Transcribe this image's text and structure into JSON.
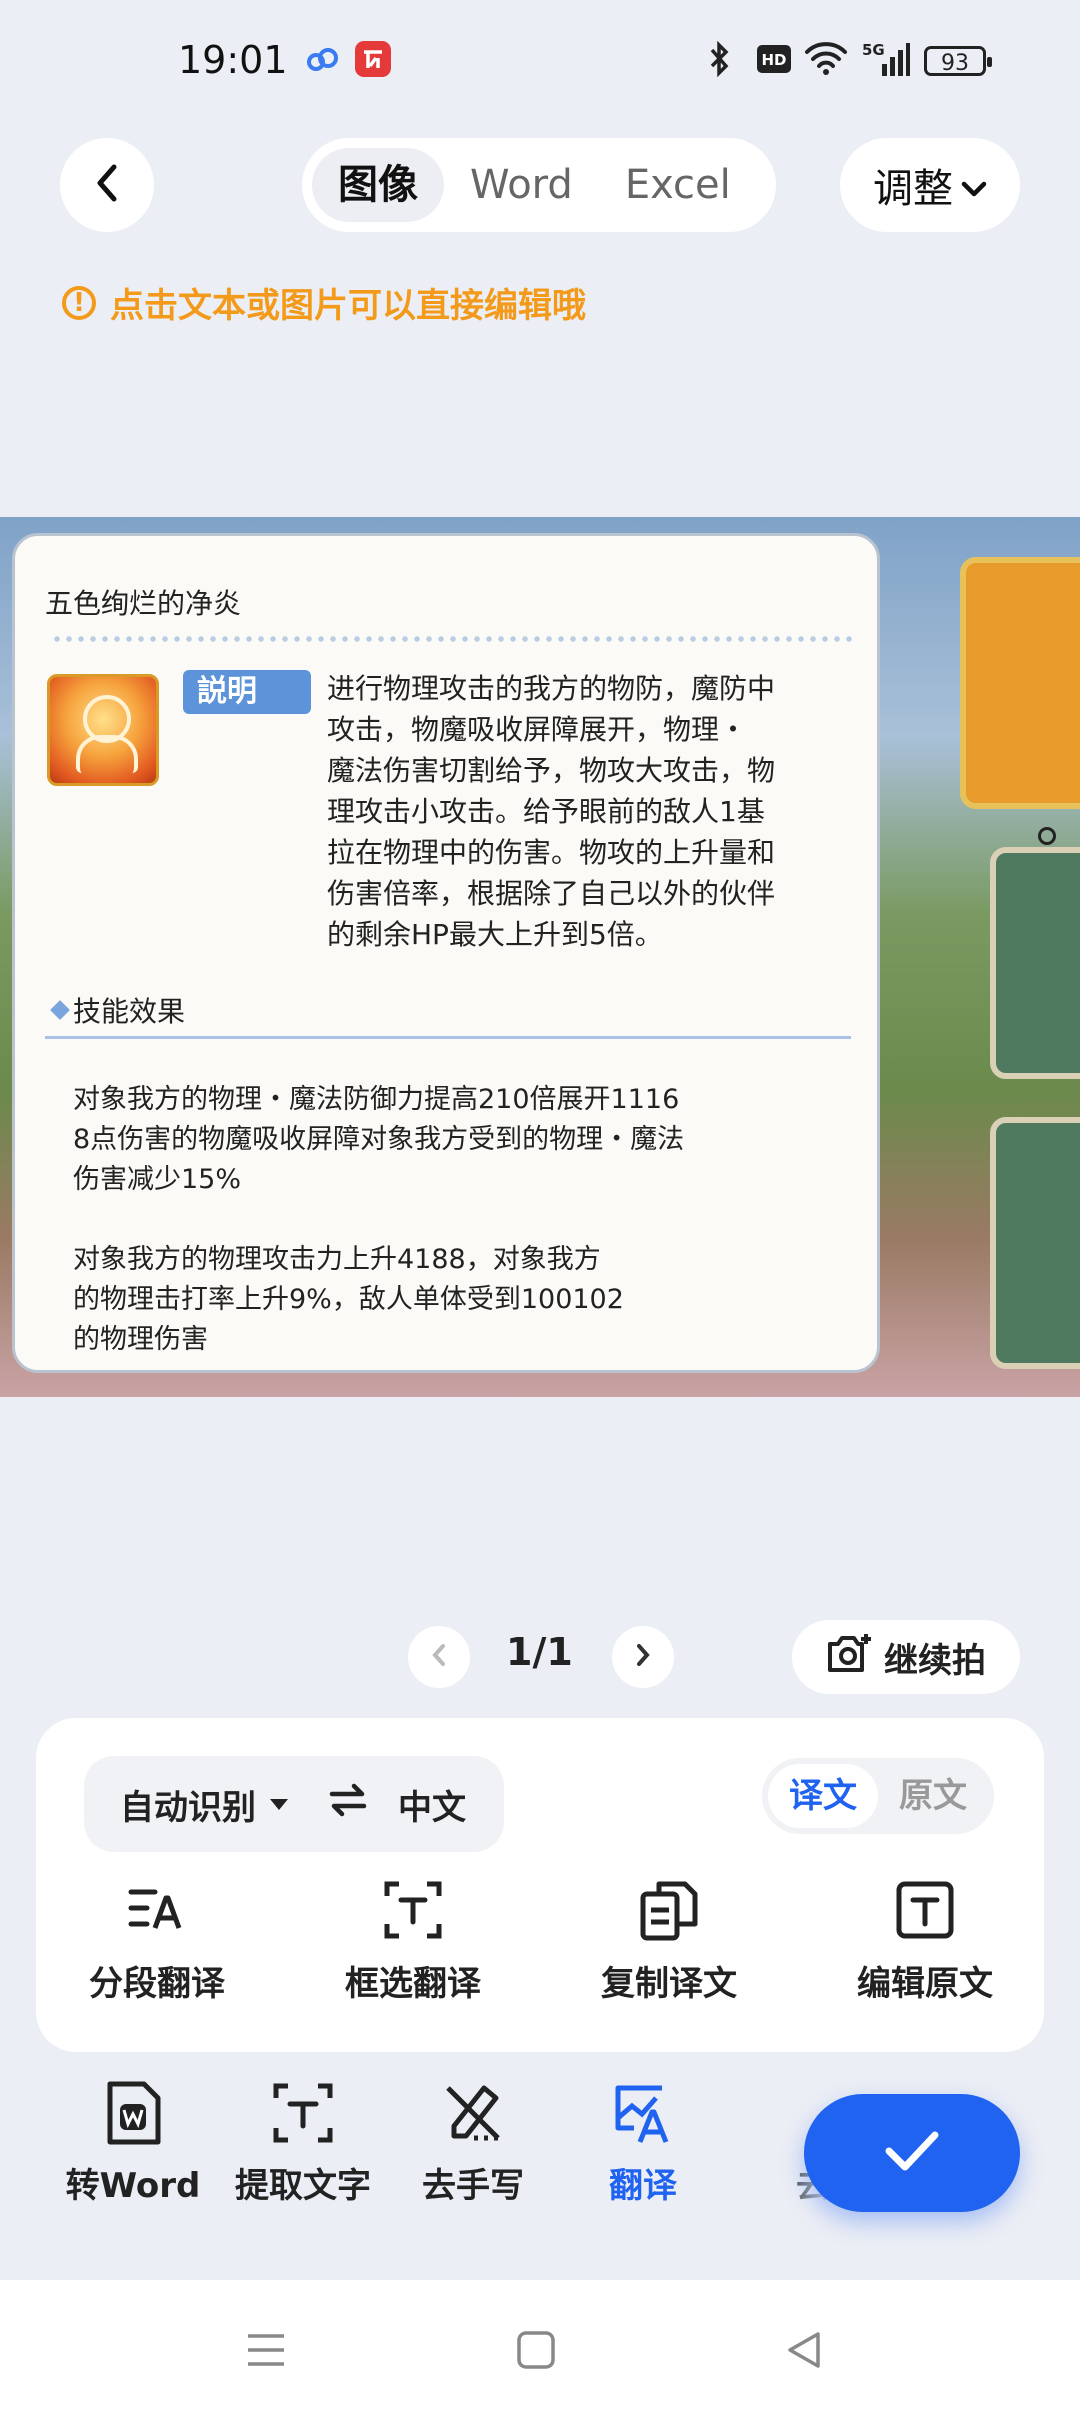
{
  "status_bar": {
    "time": "19:01",
    "battery": "93",
    "network": "5G"
  },
  "header": {
    "tabs": [
      {
        "label": "图像",
        "active": true
      },
      {
        "label": "Word",
        "active": false
      },
      {
        "label": "Excel",
        "active": false
      }
    ],
    "adjust_label": "调整",
    "tip": "点击文本或图片可以直接编辑哦"
  },
  "card": {
    "title": "五色绚烂的净炎",
    "badge": "説明",
    "description": "进行物理攻击的我方的物防，魔防中\n攻击，物魔吸收屏障展开，物理・\n魔法伤害切割给予，物攻大攻击，物\n理攻击小攻击。给予眼前的敌人1基\n拉在物理中的伤害。物攻的上升量和\n伤害倍率，根据除了自己以外的伙伴\n的剩余HP最大上升到5倍。",
    "effect_heading": "技能效果",
    "effect_1": "对象我方的物理・魔法防御力提高210倍展开1116\n8点伤害的物魔吸收屏障对象我方受到的物理・魔法\n伤害减少15%",
    "effect_2": "对象我方的物理攻击力上升4188，对象我方\n的物理击打率上升9%，敌人单体受到100102\n的物理伤害"
  },
  "pager": {
    "text": "1/1",
    "continue_label": "继续拍"
  },
  "panel": {
    "source_lang": "自动识别",
    "target_lang": "中文",
    "toggle": [
      {
        "label": "译文",
        "active": true
      },
      {
        "label": "原文",
        "active": false
      }
    ],
    "tools": [
      {
        "label": "分段翻译"
      },
      {
        "label": "框选翻译"
      },
      {
        "label": "复制译文"
      },
      {
        "label": "编辑原文"
      }
    ]
  },
  "toolbar": {
    "items": [
      {
        "label": "转Word"
      },
      {
        "label": "提取文字"
      },
      {
        "label": "去手写"
      },
      {
        "label": "翻译",
        "active": true
      },
      {
        "label": "去"
      }
    ]
  },
  "colors": {
    "accent": "#1f63f0",
    "tip": "#f39a1a",
    "background": "#eceef5"
  }
}
